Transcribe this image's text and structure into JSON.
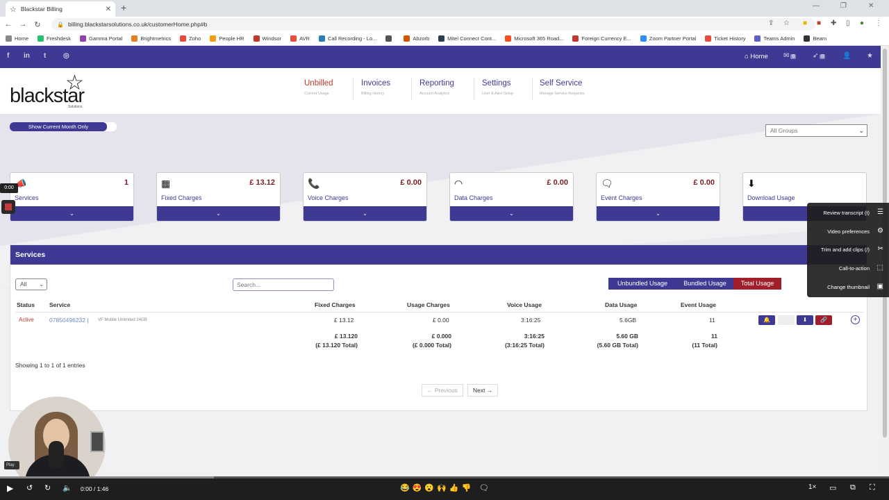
{
  "browser": {
    "tab_title": "Blackstar Billing",
    "url": "billing.blackstarsolutions.co.uk/customerHome.php#b",
    "bookmarks": [
      {
        "label": "Home",
        "color": "#888"
      },
      {
        "label": "Freshdesk",
        "color": "#25c16f"
      },
      {
        "label": "Gamma Portal",
        "color": "#8e44ad"
      },
      {
        "label": "Brightmetrics",
        "color": "#e67e22"
      },
      {
        "label": "Zoho",
        "color": "#e74c3c"
      },
      {
        "label": "People HR",
        "color": "#f39c12"
      },
      {
        "label": "Windsor",
        "color": "#c0392b"
      },
      {
        "label": "AVR",
        "color": "#e74c3c"
      },
      {
        "label": "Call Recording - Lo...",
        "color": "#2980b9"
      },
      {
        "label": "",
        "color": "#555"
      },
      {
        "label": "Abzorb",
        "color": "#d35400"
      },
      {
        "label": "Mitel Connect Cont...",
        "color": "#2c3e50"
      },
      {
        "label": "Microsoft 365 Road...",
        "color": "#f25022"
      },
      {
        "label": "Foreign Currency E...",
        "color": "#c0392b"
      },
      {
        "label": "Zoom Partner Portal",
        "color": "#2d8cff"
      },
      {
        "label": "Ticket History",
        "color": "#e74c3c"
      },
      {
        "label": "Teams Admin",
        "color": "#5b5fc7"
      },
      {
        "label": "Beam",
        "color": "#333"
      }
    ]
  },
  "topstrip": {
    "social": [
      "f",
      "in",
      "t",
      "◎"
    ],
    "home_label": "Home",
    "mail_count": "0",
    "rocket_count": "0"
  },
  "nav": [
    {
      "label": "Unbilled",
      "sub": "Current Usage"
    },
    {
      "label": "Invoices",
      "sub": "Billing History"
    },
    {
      "label": "Reporting",
      "sub": "Account Analytics"
    },
    {
      "label": "Settings",
      "sub": "User & Alert Setup"
    },
    {
      "label": "Self Service",
      "sub": "Manage Service Requests"
    }
  ],
  "logo": {
    "word": "blackstar",
    "sub": "Solutions"
  },
  "controls": {
    "toggle_label": "Show Current Month Only",
    "groups_value": "All Groups"
  },
  "cards": [
    {
      "label": "Services",
      "value": "1",
      "icon": "📣"
    },
    {
      "label": "Fixed Charges",
      "value": "£ 13.12",
      "icon": "▦"
    },
    {
      "label": "Voice Charges",
      "value": "£ 0.00",
      "icon": "📞"
    },
    {
      "label": "Data Charges",
      "value": "£ 0.00",
      "icon": "◠"
    },
    {
      "label": "Event Charges",
      "value": "£ 0.00",
      "icon": "🗨"
    },
    {
      "label": "Download Usage",
      "value": "",
      "icon": "⬇"
    }
  ],
  "services": {
    "title": "Services",
    "filter_value": "All",
    "search_placeholder": "Search...",
    "segments": [
      "Unbundled Usage",
      "Bundled Usage",
      "Total Usage"
    ],
    "columns": [
      "Status",
      "Service",
      "Fixed Charges",
      "Usage Charges",
      "Voice Usage",
      "Data Usage",
      "Event Usage"
    ],
    "row": {
      "status": "Active",
      "number": "07850496232 |",
      "plan": "VF Mobile Unlimited 24GB",
      "fixed": "£ 13.12",
      "usage": "£ 0.00",
      "voice": "3:16:25",
      "data": "5.6GB",
      "event": "11"
    },
    "totals": {
      "fixed": "£ 13.120",
      "fixed_total": "(£ 13.120 Total)",
      "usage": "£ 0.000",
      "usage_total": "(£ 0.000 Total)",
      "voice": "3:16:25",
      "voice_total": "(3:16:25 Total)",
      "data": "5.60 GB",
      "data_total": "(5.60 GB Total)",
      "event": "11",
      "event_total": "(11 Total)"
    },
    "showing": "Showing 1 to 1 of 1 entries",
    "prev": "← Previous",
    "next": "Next →"
  },
  "player": {
    "time_chip": "0:00",
    "menu": [
      "Review transcript (t)",
      "Video preferences",
      "Trim and add clips (/)",
      "Call-to-action",
      "Change thumbnail"
    ],
    "time": "0:00 / 1:46",
    "play_tip": "Play",
    "speed": "1×",
    "emojis": "😂😍😮🙌👍👎",
    "progress": 0.0
  },
  "colors": {
    "brand": "#3e3a94",
    "active": "#c0392b",
    "value": "#7a1b22"
  }
}
